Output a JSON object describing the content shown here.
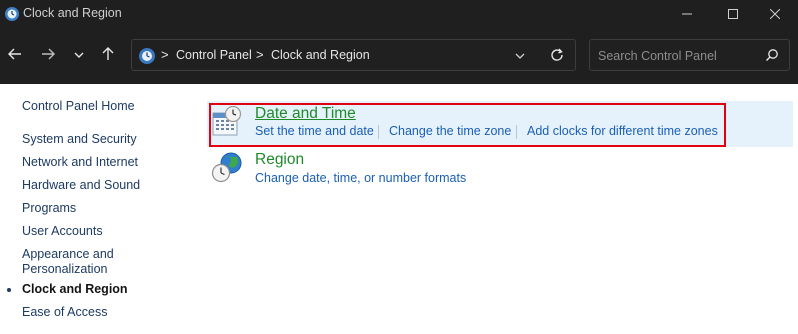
{
  "window": {
    "title": "Clock and Region",
    "controls": [
      "minimize-icon",
      "maximize-icon",
      "close-icon"
    ]
  },
  "navigation": {
    "back_icon": "arrow-left-icon",
    "forward_icon": "arrow-right-icon",
    "recent_icon": "chevron-down-icon",
    "up_icon": "arrow-up-icon"
  },
  "address_bar": {
    "breadcrumbs": [
      "Control Panel",
      "Clock and Region"
    ],
    "separator": ">",
    "dropdown_icon": "chevron-down-icon",
    "refresh_icon": "refresh-icon"
  },
  "search": {
    "placeholder": "Search Control Panel",
    "icon": "search-icon"
  },
  "sidebar": {
    "home": "Control Panel Home",
    "items": [
      {
        "label": "System and Security"
      },
      {
        "label": "Network and Internet"
      },
      {
        "label": "Hardware and Sound"
      },
      {
        "label": "Programs"
      },
      {
        "label": "User Accounts"
      },
      {
        "label": "Appearance and\nPersonalization",
        "line1": "Appearance and",
        "line2": "Personalization"
      },
      {
        "label": "Clock and Region",
        "active": true
      },
      {
        "label": "Ease of Access"
      }
    ]
  },
  "categories": [
    {
      "title": "Date and Time",
      "icon": "calendar-clock-icon",
      "links": [
        "Set the time and date",
        "Change the time zone",
        "Add clocks for different time zones"
      ],
      "highlighted": true
    },
    {
      "title": "Region",
      "icon": "globe-clock-icon",
      "links": [
        "Change date, time, or number formats"
      ]
    }
  ],
  "colors": {
    "titlebar": "#1f1f1f",
    "link": "#1a5fb4",
    "category_title": "#1f8a2a",
    "highlight": "#e6f2fb",
    "annotation_border": "#e0000f"
  }
}
